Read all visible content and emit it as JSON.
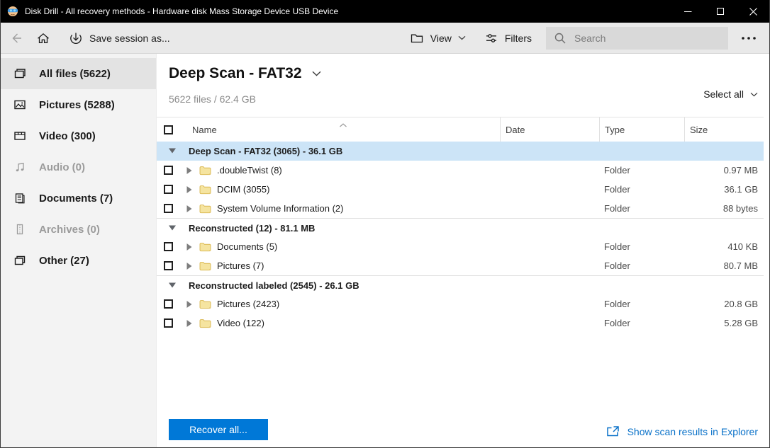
{
  "window": {
    "title": "Disk Drill - All recovery methods - Hardware disk Mass Storage Device USB Device"
  },
  "toolbar": {
    "save_session_label": "Save session as...",
    "view_label": "View",
    "filters_label": "Filters",
    "search_placeholder": "Search"
  },
  "sidebar": {
    "items": [
      {
        "label": "All files (5622)",
        "icon": "all-files",
        "selected": true,
        "disabled": false
      },
      {
        "label": "Pictures (5288)",
        "icon": "pictures",
        "selected": false,
        "disabled": false
      },
      {
        "label": "Video (300)",
        "icon": "video",
        "selected": false,
        "disabled": false
      },
      {
        "label": "Audio (0)",
        "icon": "audio",
        "selected": false,
        "disabled": true
      },
      {
        "label": "Documents (7)",
        "icon": "documents",
        "selected": false,
        "disabled": false
      },
      {
        "label": "Archives (0)",
        "icon": "archives",
        "selected": false,
        "disabled": true
      },
      {
        "label": "Other (27)",
        "icon": "other",
        "selected": false,
        "disabled": false
      }
    ]
  },
  "main": {
    "title": "Deep Scan - FAT32",
    "subtitle": "5622 files / 62.4 GB",
    "select_all_label": "Select all",
    "table": {
      "columns": [
        "Name",
        "Date",
        "Type",
        "Size"
      ],
      "sort_column": "Name",
      "sort_direction": "ascending",
      "groups": [
        {
          "label": "Deep Scan - FAT32 (3065) - 36.1 GB",
          "selected": true,
          "rows": [
            {
              "name": ".doubleTwist (8)",
              "date": "",
              "type": "Folder",
              "size": "0.97 MB"
            },
            {
              "name": "DCIM (3055)",
              "date": "",
              "type": "Folder",
              "size": "36.1 GB"
            },
            {
              "name": "System Volume Information (2)",
              "date": "",
              "type": "Folder",
              "size": "88 bytes"
            }
          ]
        },
        {
          "label": "Reconstructed (12) - 81.1 MB",
          "selected": false,
          "rows": [
            {
              "name": "Documents (5)",
              "date": "",
              "type": "Folder",
              "size": "410 KB"
            },
            {
              "name": "Pictures (7)",
              "date": "",
              "type": "Folder",
              "size": "80.7 MB"
            }
          ]
        },
        {
          "label": "Reconstructed labeled (2545) - 26.1 GB",
          "selected": false,
          "rows": [
            {
              "name": "Pictures (2423)",
              "date": "",
              "type": "Folder",
              "size": "20.8 GB"
            },
            {
              "name": "Video (122)",
              "date": "",
              "type": "Folder",
              "size": "5.28 GB"
            }
          ]
        }
      ]
    },
    "footer": {
      "recover_button_label": "Recover all...",
      "explorer_link_label": "Show scan results in Explorer"
    }
  },
  "icons": {
    "titlebar": "disk-drill-mascot",
    "window_controls": [
      "minimize",
      "maximize",
      "close"
    ],
    "toolbar": [
      "back-arrow",
      "home",
      "save-download",
      "view-folder",
      "filters-sliders",
      "search-magnifier",
      "more-dots"
    ],
    "rows": [
      "collapse-triangle",
      "expand-triangle",
      "yellow-folder"
    ],
    "footer_link": "open-in-explorer"
  },
  "colors": {
    "titlebar_bg": "#000000",
    "toolbar_bg": "#e9e9e9",
    "sidebar_bg": "#f3f3f3",
    "sidebar_selected_bg": "#e3e3e3",
    "selected_group_row_bg": "#cce4f7",
    "accent_blue": "#0078d7",
    "link_blue": "#0b72c9",
    "folder_yellow": "#f5e4a0",
    "disabled_text": "#9b9b9b"
  }
}
